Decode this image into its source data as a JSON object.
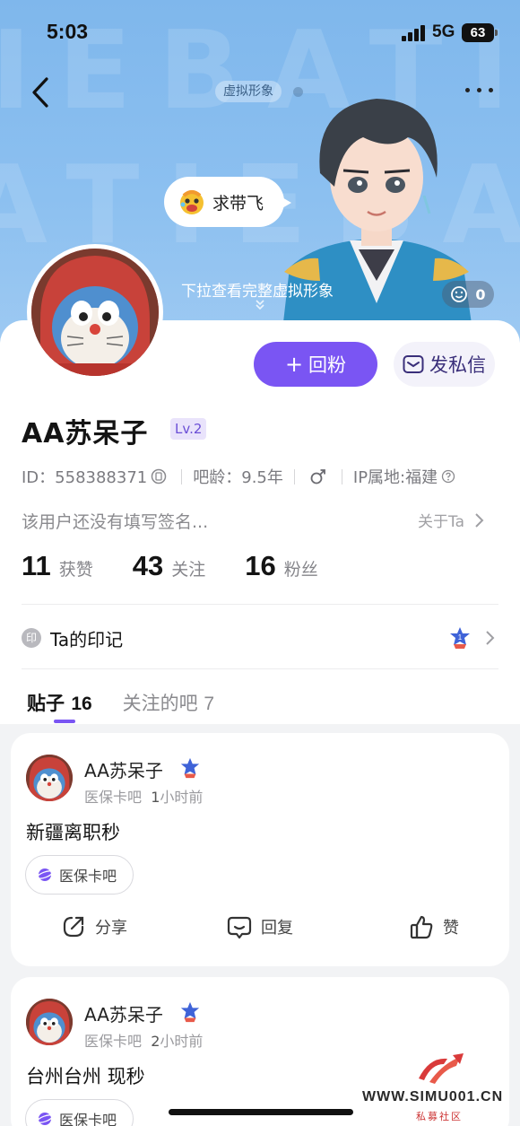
{
  "status_bar": {
    "time": "5:03",
    "network": "5G",
    "battery": "63"
  },
  "header": {
    "avatar_tag": "虚拟形象",
    "bubble_text": "求带飞",
    "pull_hint": "下拉查看完整虚拟形象",
    "like_count": "0"
  },
  "actions": {
    "follow_back": "回粉",
    "message": "发私信"
  },
  "profile": {
    "name": "AA苏呆子",
    "level": "Lv.2",
    "id": "ID：558388371",
    "bar_age": "吧龄：9.5年",
    "ip": "IP属地:福建",
    "signature": "该用户还没有填写签名...",
    "about": "关于Ta"
  },
  "stats": [
    {
      "num": "11",
      "label": "获赞"
    },
    {
      "num": "43",
      "label": "关注"
    },
    {
      "num": "16",
      "label": "粉丝"
    }
  ],
  "marks": {
    "icon_text": "印",
    "label": "Ta的印记"
  },
  "tabs": [
    {
      "label": "贴子",
      "count": "16"
    },
    {
      "label": "关注的吧",
      "count": "7"
    }
  ],
  "posts": [
    {
      "author": "AA苏呆子",
      "forum": "医保卡吧",
      "time_num": "1",
      "time_unit": "小时前",
      "title": "新疆离职秒",
      "chip": "医保卡吧",
      "share": "分享",
      "reply": "回复",
      "like": "赞"
    },
    {
      "author": "AA苏呆子",
      "forum": "医保卡吧",
      "time_num": "2",
      "time_unit": "小时前",
      "title": "台州台州  现秒",
      "chip": "医保卡吧"
    }
  ],
  "watermark": {
    "site": "WWW.SIMU001.CN",
    "cn": "私募社区"
  },
  "colors": {
    "accent": "#7a55f3",
    "header_bg": "#8cc0f0"
  }
}
